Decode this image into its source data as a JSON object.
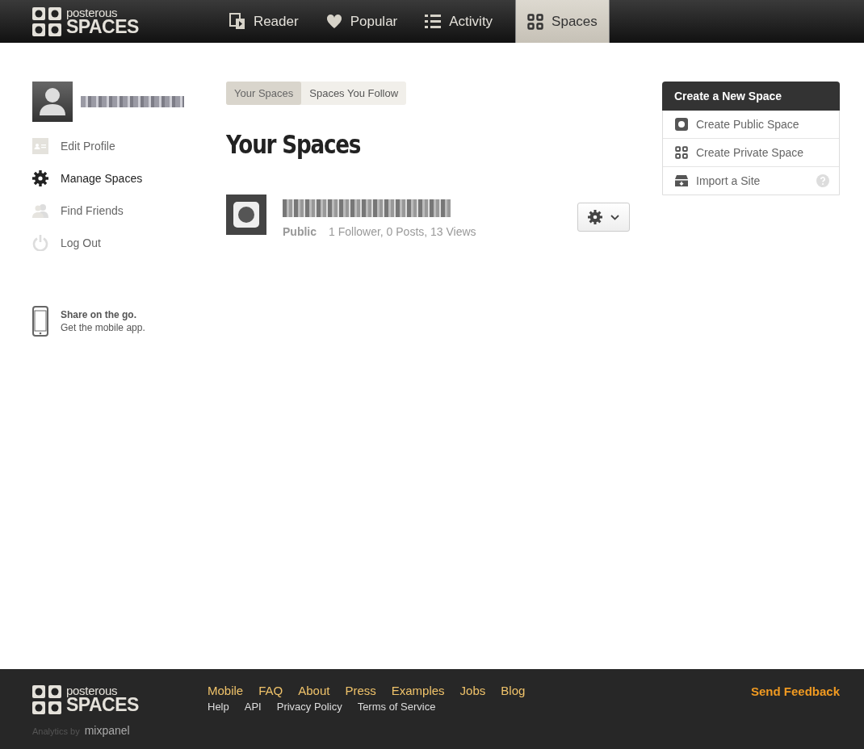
{
  "header": {
    "logo": {
      "top": "posterous",
      "bottom": "SPACES"
    },
    "nav": [
      {
        "label": "Reader",
        "selected": false
      },
      {
        "label": "Popular",
        "selected": false
      },
      {
        "label": "Activity",
        "selected": false
      },
      {
        "label": "Spaces",
        "selected": true
      }
    ]
  },
  "sidebar": {
    "items": [
      {
        "label": "Edit Profile",
        "selected": false
      },
      {
        "label": "Manage Spaces",
        "selected": true
      },
      {
        "label": "Find Friends",
        "selected": false
      },
      {
        "label": "Log Out",
        "selected": false
      }
    ],
    "promo": {
      "title": "Share on the go.",
      "text": "Get the mobile app."
    }
  },
  "tabs": [
    {
      "label": "Your Spaces",
      "selected": true
    },
    {
      "label": "Spaces You Follow",
      "selected": false
    }
  ],
  "heading": "Your Spaces",
  "spaces": [
    {
      "visibility": "Public",
      "stats": "1 Follower,  0 Posts,  13 Views"
    }
  ],
  "create_panel": {
    "title": "Create a New Space",
    "items": [
      {
        "label": "Create Public Space",
        "help": false
      },
      {
        "label": "Create Private Space",
        "help": false
      },
      {
        "label": "Import a Site",
        "help": true
      }
    ]
  },
  "footer": {
    "logo": {
      "top": "posterous",
      "bottom": "SPACES"
    },
    "primary_links": [
      "Mobile",
      "FAQ",
      "About",
      "Press",
      "Examples",
      "Jobs",
      "Blog"
    ],
    "secondary_links": [
      "Help",
      "API",
      "Privacy Policy",
      "Terms of Service"
    ],
    "analytics": {
      "label": "Analytics by",
      "brand": "mixpanel"
    },
    "feedback": "Send Feedback"
  }
}
